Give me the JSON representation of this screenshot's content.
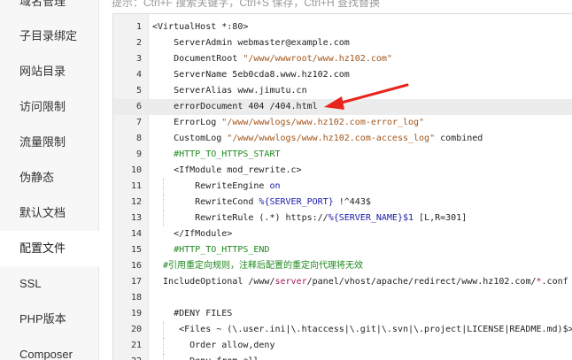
{
  "sidebar": {
    "items": [
      {
        "label": "域名管理"
      },
      {
        "label": "子目录绑定"
      },
      {
        "label": "网站目录"
      },
      {
        "label": "访问限制"
      },
      {
        "label": "流量限制"
      },
      {
        "label": "伪静态"
      },
      {
        "label": "默认文档"
      },
      {
        "label": "配置文件",
        "active": true
      },
      {
        "label": "SSL"
      },
      {
        "label": "PHP版本"
      },
      {
        "label": "Composer"
      }
    ]
  },
  "hint": "提示：Ctrl+F 搜索关键字，Ctrl+S 保存，Ctrl+H 查找替换",
  "editor": {
    "active_line": 6,
    "lines": [
      {
        "n": "1",
        "parts": [
          {
            "t": "<VirtualHost *:80>",
            "c": ""
          }
        ]
      },
      {
        "n": "2",
        "parts": [
          {
            "t": "    ServerAdmin webmaster@example.com",
            "c": ""
          }
        ]
      },
      {
        "n": "3",
        "parts": [
          {
            "t": "    DocumentRoot ",
            "c": ""
          },
          {
            "t": "\"/www/wwwroot/www.hz102.com\"",
            "c": "tok-str"
          }
        ]
      },
      {
        "n": "4",
        "parts": [
          {
            "t": "    ServerName 5eb0cda8.www.hz102.com",
            "c": ""
          }
        ]
      },
      {
        "n": "5",
        "parts": [
          {
            "t": "    ServerAlias www.jimutu.cn",
            "c": ""
          }
        ]
      },
      {
        "n": "6",
        "parts": [
          {
            "t": "    errorDocument 404 /404.html",
            "c": ""
          }
        ]
      },
      {
        "n": "7",
        "parts": [
          {
            "t": "    ErrorLog ",
            "c": ""
          },
          {
            "t": "\"/www/wwwlogs/www.hz102.com-error_log\"",
            "c": "tok-str"
          }
        ]
      },
      {
        "n": "8",
        "parts": [
          {
            "t": "    CustomLog ",
            "c": ""
          },
          {
            "t": "\"/www/wwwlogs/www.hz102.com-access_log\"",
            "c": "tok-str"
          },
          {
            "t": " combined",
            "c": ""
          }
        ]
      },
      {
        "n": "9",
        "parts": [
          {
            "t": "    #HTTP_TO_HTTPS_START",
            "c": "tok-cmt"
          }
        ]
      },
      {
        "n": "10",
        "parts": [
          {
            "t": "    <IfModule mod_rewrite.c>",
            "c": ""
          }
        ]
      },
      {
        "n": "11",
        "parts": [
          {
            "t": "        RewriteEngine ",
            "c": ""
          },
          {
            "t": "on",
            "c": "tok-var"
          }
        ]
      },
      {
        "n": "12",
        "parts": [
          {
            "t": "        RewriteCond ",
            "c": ""
          },
          {
            "t": "%{SERVER_PORT}",
            "c": "tok-var"
          },
          {
            "t": " !^443$",
            "c": ""
          }
        ]
      },
      {
        "n": "13",
        "parts": [
          {
            "t": "        RewriteRule (.*) https://",
            "c": ""
          },
          {
            "t": "%{SERVER_NAME}",
            "c": "tok-var"
          },
          {
            "t": "$1",
            "c": "tok-var"
          },
          {
            "t": " [L,R=301]",
            "c": ""
          }
        ]
      },
      {
        "n": "14",
        "parts": [
          {
            "t": "    </IfModule>",
            "c": ""
          }
        ]
      },
      {
        "n": "15",
        "parts": [
          {
            "t": "    #HTTP_TO_HTTPS_END",
            "c": "tok-cmt"
          }
        ]
      },
      {
        "n": "16",
        "parts": [
          {
            "t": "  #引用重定向规则，注释后配置的重定向代理将无效",
            "c": "tok-cmt"
          }
        ]
      },
      {
        "n": "17",
        "parts": [
          {
            "t": "  IncludeOptional /www/",
            "c": ""
          },
          {
            "t": "server",
            "c": "tok-path"
          },
          {
            "t": "/panel/vhost/apache/redirect/www.hz102.com/",
            "c": ""
          },
          {
            "t": "*",
            "c": "tok-path"
          },
          {
            "t": ".conf",
            "c": ""
          }
        ]
      },
      {
        "n": "18",
        "parts": [
          {
            "t": "",
            "c": ""
          }
        ]
      },
      {
        "n": "19",
        "parts": [
          {
            "t": "    #DENY FILES",
            "c": ""
          }
        ]
      },
      {
        "n": "20",
        "parts": [
          {
            "t": "     <Files ~ (\\.user.ini|\\.htaccess|\\.git|\\.svn|\\.project|LICENSE|README.md)$>",
            "c": ""
          }
        ]
      },
      {
        "n": "21",
        "parts": [
          {
            "t": "       Order allow,deny",
            "c": ""
          }
        ]
      },
      {
        "n": "22",
        "parts": [
          {
            "t": "       Deny from all",
            "c": ""
          }
        ]
      }
    ]
  },
  "colors": {
    "arrow": "#e8251c"
  }
}
